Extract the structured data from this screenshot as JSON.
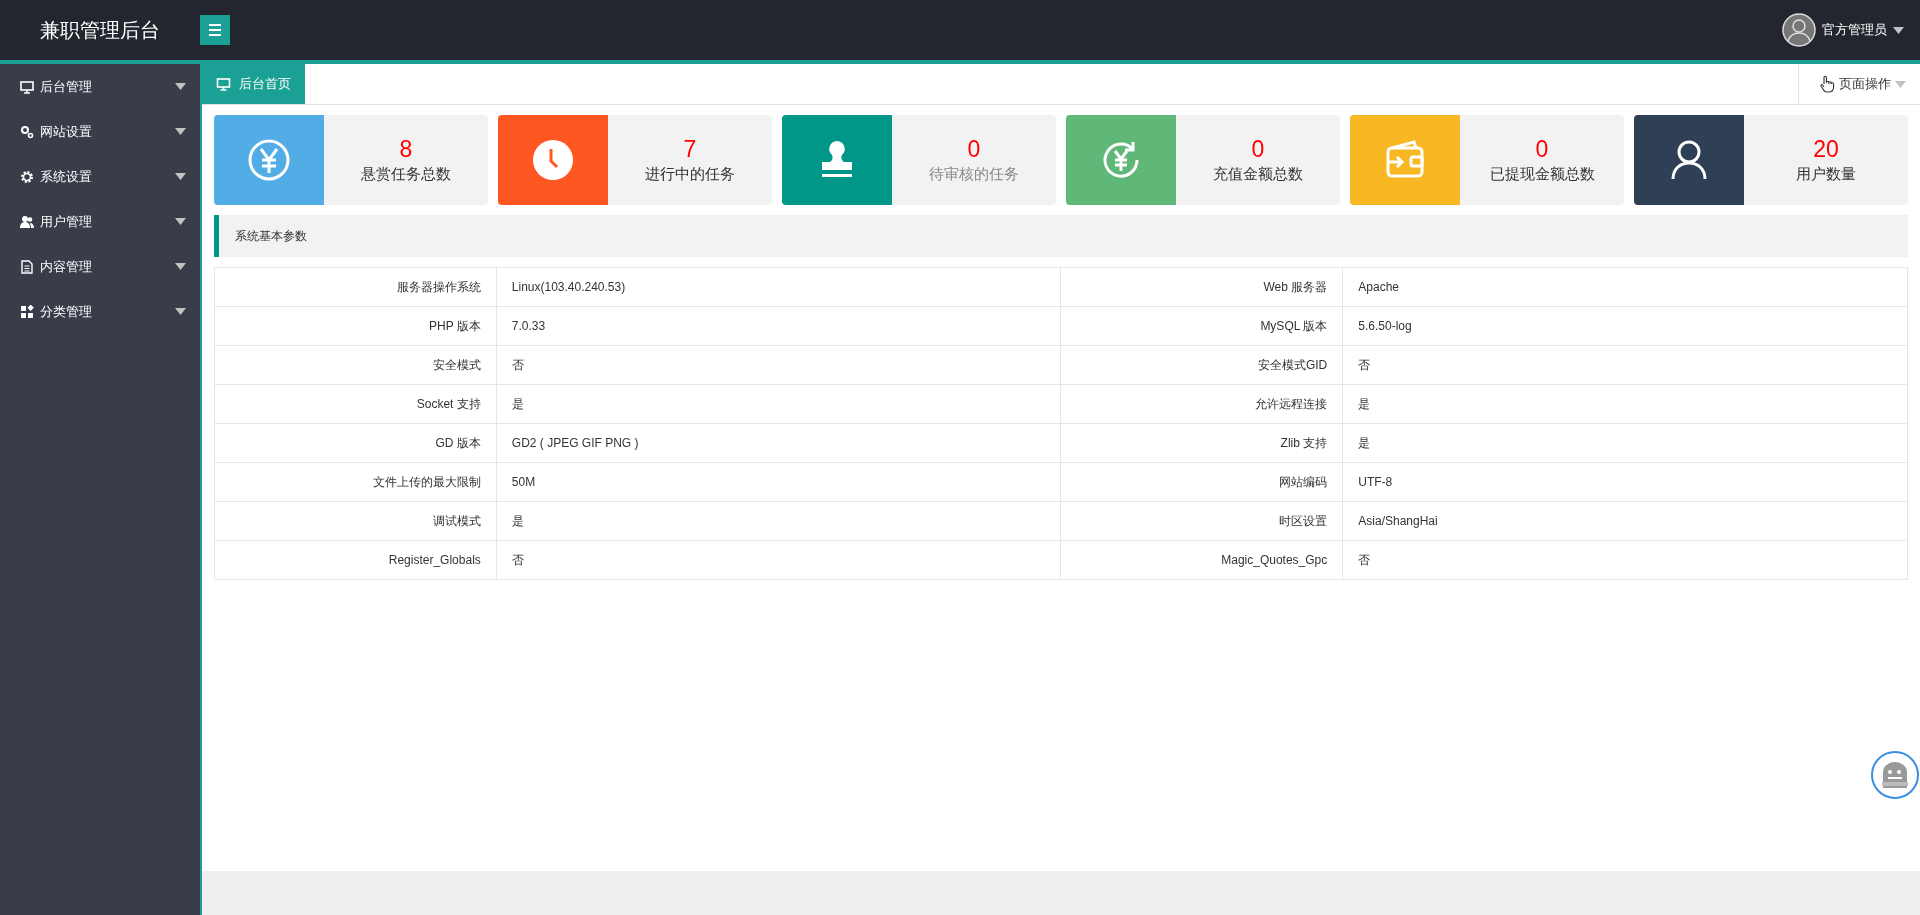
{
  "header": {
    "title": "兼职管理后台",
    "user": "官方管理员"
  },
  "sidebar": {
    "items": [
      {
        "label": "后台管理",
        "kind": "monitor",
        "expanded": false
      },
      {
        "label": "网站设置",
        "kind": "gears",
        "expanded": false
      },
      {
        "label": "系统设置",
        "kind": "gear",
        "expanded": false
      },
      {
        "label": "用户管理",
        "kind": "users",
        "expanded": false
      },
      {
        "label": "内容管理",
        "kind": "document",
        "expanded": false
      },
      {
        "label": "分类管理",
        "kind": "blocks",
        "expanded": false
      }
    ]
  },
  "tabs": [
    {
      "label": "后台首页",
      "selected": true
    }
  ],
  "page_actions": "页面操作",
  "stats": [
    {
      "value": "8",
      "label": "悬赏任务总数",
      "kind": "yen",
      "color": "#52ace5",
      "dimmed": false
    },
    {
      "value": "7",
      "label": "进行中的任务",
      "kind": "clock",
      "color": "#ff5722",
      "dimmed": false
    },
    {
      "value": "0",
      "label": "待审核的任务",
      "kind": "stamp",
      "color": "#009688",
      "dimmed": true
    },
    {
      "value": "0",
      "label": "充值金额总数",
      "kind": "yen-refresh",
      "color": "#5fb878",
      "dimmed": false
    },
    {
      "value": "0",
      "label": "已提现金额总数",
      "kind": "wallet",
      "color": "#f7b824",
      "dimmed": false
    },
    {
      "value": "20",
      "label": "用户数量",
      "kind": "user",
      "color": "#2f3f56",
      "dimmed": false
    }
  ],
  "section_title": "系统基本参数",
  "params": [
    [
      "服务器操作系统",
      "Linux(103.40.240.53)",
      "Web 服务器",
      "Apache"
    ],
    [
      "PHP 版本",
      "7.0.33",
      "MySQL 版本",
      "5.6.50-log"
    ],
    [
      "安全模式",
      "否",
      "安全模式GID",
      "否"
    ],
    [
      "Socket 支持",
      "是",
      "允许远程连接",
      "是"
    ],
    [
      "GD 版本",
      "GD2 ( JPEG GIF PNG )",
      "Zlib 支持",
      "是"
    ],
    [
      "文件上传的最大限制",
      "50M",
      "网站编码",
      "UTF-8"
    ],
    [
      "调试模式",
      "是",
      "时区设置",
      "Asia/ShangHai"
    ],
    [
      "Register_Globals",
      "否",
      "Magic_Quotes_Gpc",
      "否"
    ]
  ]
}
